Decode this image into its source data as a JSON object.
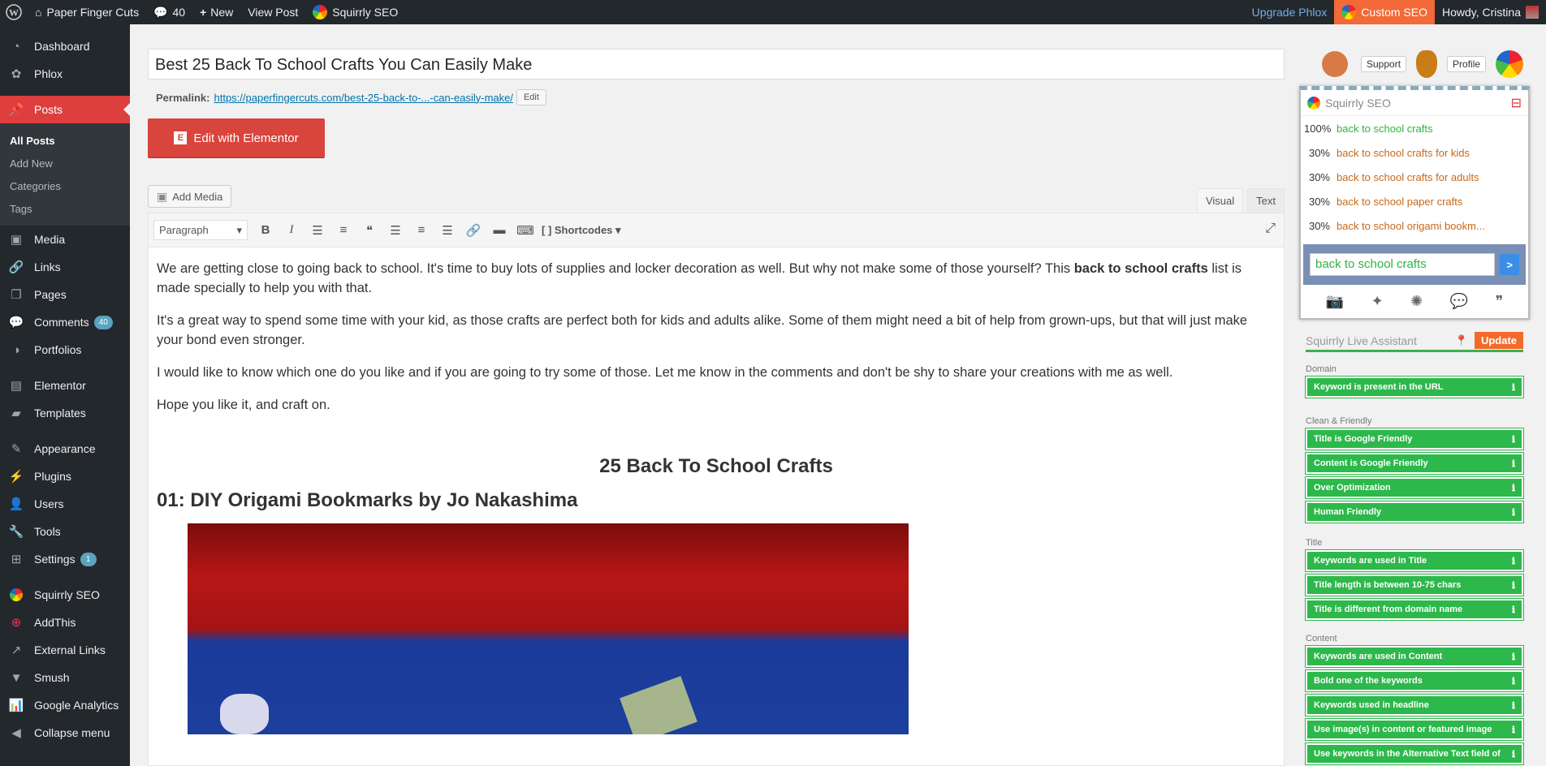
{
  "adminbar": {
    "site_name": "Paper Finger Cuts",
    "comments_count": "40",
    "new_label": "New",
    "view_post": "View Post",
    "squirrly": "Squirrly SEO",
    "upgrade": "Upgrade Phlox",
    "custom_seo": "Custom SEO",
    "howdy": "Howdy, Cristina"
  },
  "sidebar": {
    "dashboard": "Dashboard",
    "phlox": "Phlox",
    "posts": "Posts",
    "posts_sub": [
      "All Posts",
      "Add New",
      "Categories",
      "Tags"
    ],
    "media": "Media",
    "links": "Links",
    "pages": "Pages",
    "comments": "Comments",
    "comments_badge": "40",
    "portfolios": "Portfolios",
    "elementor": "Elementor",
    "templates": "Templates",
    "appearance": "Appearance",
    "plugins": "Plugins",
    "users": "Users",
    "tools": "Tools",
    "settings": "Settings",
    "settings_badge": "1",
    "squirrly": "Squirrly SEO",
    "addthis": "AddThis",
    "external_links": "External Links",
    "smush": "Smush",
    "google_analytics": "Google Analytics",
    "collapse": "Collapse menu"
  },
  "editor": {
    "title": "Best 25 Back To School Crafts You Can Easily Make",
    "permalink_label": "Permalink:",
    "permalink_url": "https://paperfingercuts.com/best-25-back-to-...-can-easily-make/",
    "edit_label": "Edit",
    "elementor_btn": "Edit with Elementor",
    "add_media": "Add Media",
    "tab_visual": "Visual",
    "tab_text": "Text",
    "format_select": "Paragraph",
    "shortcodes": "Shortcodes",
    "p1_before": "We are getting close to going back to school. It's time to buy lots of supplies and locker decoration as well. But why not make some of those yourself? This ",
    "p1_bold": "back to school crafts",
    "p1_after": " list is made specially to help you with that.",
    "p2": "It's a great way to spend some time with your kid, as those crafts are perfect both for kids and adults alike. Some of them might need a bit of help from grown-ups, but that will just make your bond even stronger.",
    "p3": "I would like to know which one do you like and if you are going to try some of those. Let me know in the comments and don't be shy to share your creations with me as well.",
    "p4": "Hope you like it, and craft on.",
    "h2": "25 Back To School Crafts",
    "h3": "01: DIY Origami Bookmarks by Jo Nakashima"
  },
  "squirrly": {
    "support": "Support",
    "profile": "Profile",
    "header": "Squirrly SEO",
    "keywords": [
      {
        "pct": "100%",
        "text": "back to school crafts"
      },
      {
        "pct": "30%",
        "text": "back to school crafts for kids"
      },
      {
        "pct": "30%",
        "text": "back to school crafts for adults"
      },
      {
        "pct": "30%",
        "text": "back to school paper crafts"
      },
      {
        "pct": "30%",
        "text": "back to school origami bookm..."
      }
    ],
    "input_value": "back to school crafts",
    "go": ">",
    "live_assistant": "Squirrly Live Assistant",
    "update": "Update",
    "groups": {
      "domain": "Domain",
      "clean": "Clean & Friendly",
      "title": "Title",
      "content": "Content"
    },
    "domain_items": [
      "Keyword is present in the URL"
    ],
    "clean_items": [
      "Title is Google Friendly",
      "Content is Google Friendly",
      "Over Optimization",
      "Human Friendly"
    ],
    "title_items": [
      "Keywords are used in Title",
      "Title length is between 10-75 chars",
      "Title is different from domain name"
    ],
    "content_items": [
      "Keywords are used in Content",
      "Bold one of the keywords",
      "Keywords used in headline",
      "Use image(s) in content or featured image",
      "Use keywords in the Alternative Text field of"
    ]
  }
}
